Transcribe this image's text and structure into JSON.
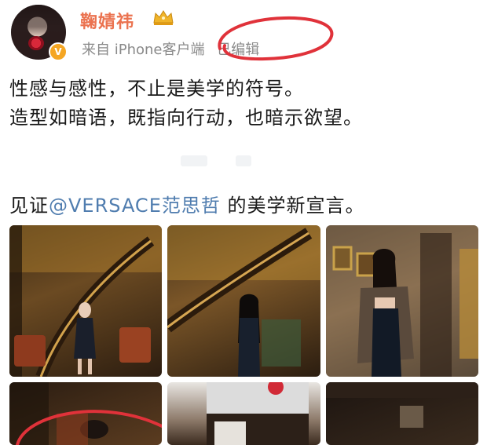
{
  "post": {
    "username": "鞠婧祎",
    "source_prefix": "来自",
    "source_device": "iPhone客户端",
    "edited_label": "已编辑",
    "verified_badge": "V",
    "lines": [
      "性感与感性，不止是美学的符号。",
      "造型如暗语，既指向行动，也暗示欲望。"
    ],
    "witness_prefix": "见证",
    "mention": "@VERSACE范思哲",
    "witness_suffix": " 的美学新宣言。"
  },
  "icons": {
    "crown": "vip-crown-icon",
    "verified": "verified-v-icon"
  },
  "colors": {
    "username": "#eb7350",
    "mention": "#507daf",
    "annotation_red": "#e0323a",
    "meta_gray": "#8a8a8a"
  },
  "images": [
    {
      "name": "photo-staircase-1"
    },
    {
      "name": "photo-staircase-2"
    },
    {
      "name": "photo-hallway"
    },
    {
      "name": "photo-4"
    },
    {
      "name": "photo-5"
    },
    {
      "name": "photo-6"
    }
  ]
}
